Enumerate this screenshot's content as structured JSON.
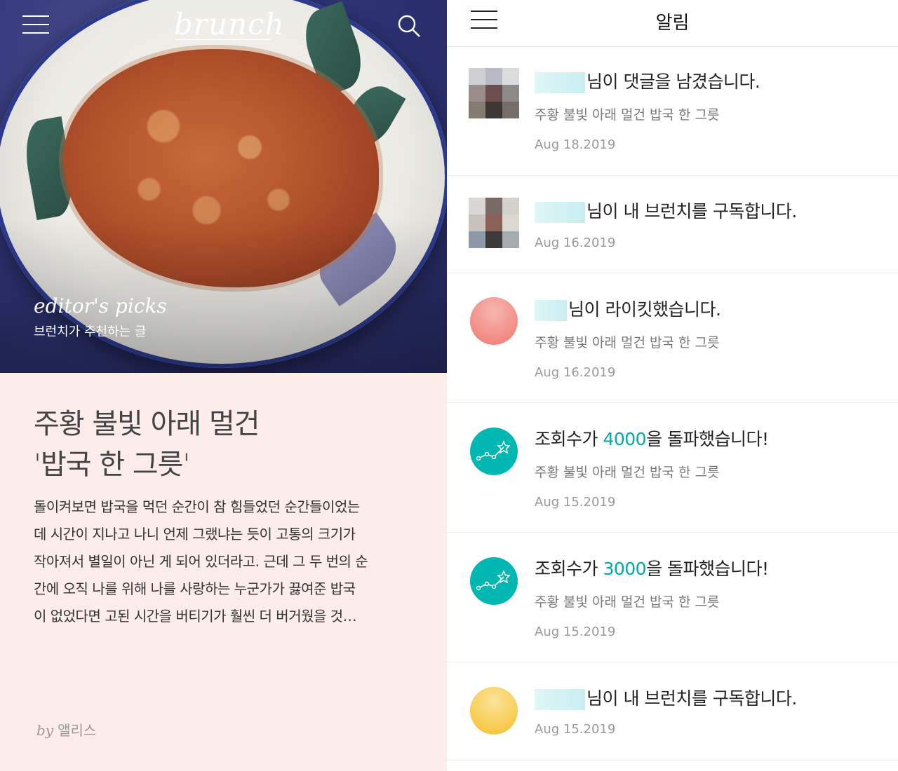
{
  "left": {
    "brand": "brunch",
    "hero_label": "editor's picks",
    "hero_sub": "브런치가 추천하는 글",
    "article_title_line1": "주황 불빛 아래 멀건",
    "article_title_line2": "'밥국 한 그릇'",
    "excerpt_lines": [
      "돌이켜보면 밥국을 먹던 순간이 참 힘들었던 순간들이었는",
      "데 시간이 지나고 나니 언제 그랬냐는 듯이 고통의 크기가",
      "작아져서 별일이 아닌 게 되어 있더라고. 근데 그 두 번의 순",
      "간에 오직 나를 위해 나를 사랑하는 누군가가 끓여준 밥국",
      "이 없었다면 고된 시간을 버티기가 훨씬 더 버거웠을 것…"
    ],
    "by": "by",
    "author": "앨리스"
  },
  "right": {
    "title": "알림",
    "notifications": [
      {
        "text": "님이 댓글을 남겼습니다.",
        "subtitle": "주황 불빛 아래 멀건 밥국 한 그릇",
        "date": "Aug 18.2019"
      },
      {
        "text": "님이 내 브런치를 구독합니다.",
        "date": "Aug 16.2019"
      },
      {
        "text": "님이 라이킷했습니다.",
        "subtitle": "주황 불빛 아래 멀건 밥국 한 그릇",
        "date": "Aug 16.2019"
      },
      {
        "text_before": "조회수가 ",
        "highlight": "4000",
        "text_after": "을 돌파했습니다!",
        "subtitle": "주황 불빛 아래 멀건 밥국 한 그릇",
        "date": "Aug 15.2019"
      },
      {
        "text_before": "조회수가 ",
        "highlight": "3000",
        "text_after": "을 돌파했습니다!",
        "subtitle": "주황 불빛 아래 멀건 밥국 한 그릇",
        "date": "Aug 15.2019"
      },
      {
        "text": "님이 내 브런치를 구독합니다.",
        "date": "Aug 15.2019"
      }
    ]
  },
  "colors": {
    "accent_teal": "#00b7b1",
    "article_bg": "#fcecea",
    "highlight": "#00a8b0"
  },
  "icons": [
    "menu-icon",
    "search-icon",
    "stats-star-icon"
  ]
}
